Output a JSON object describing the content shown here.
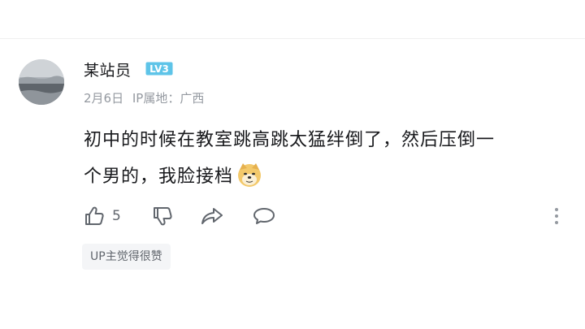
{
  "comment": {
    "username": "某站员",
    "level": "LV3",
    "date": "2月6日",
    "ip_location": "IP属地：广西",
    "text_line1": "初中的时候在教室跳高跳太猛绊倒了，然后压倒一",
    "text_line2": "个男的，我脸接档",
    "emoji": "doge-emoji",
    "like_count": "5",
    "up_tag": "UP主觉得很赞"
  },
  "colors": {
    "level_badge": "#5ec4e8",
    "text": "#18191c",
    "meta": "#9499a0",
    "icon": "#61666d",
    "tag_bg": "#f4f5f7"
  },
  "icons": {
    "like": "thumbs-up-icon",
    "dislike": "thumbs-down-icon",
    "share": "share-arrow-icon",
    "reply": "speech-bubble-icon",
    "more": "more-vertical-icon"
  }
}
